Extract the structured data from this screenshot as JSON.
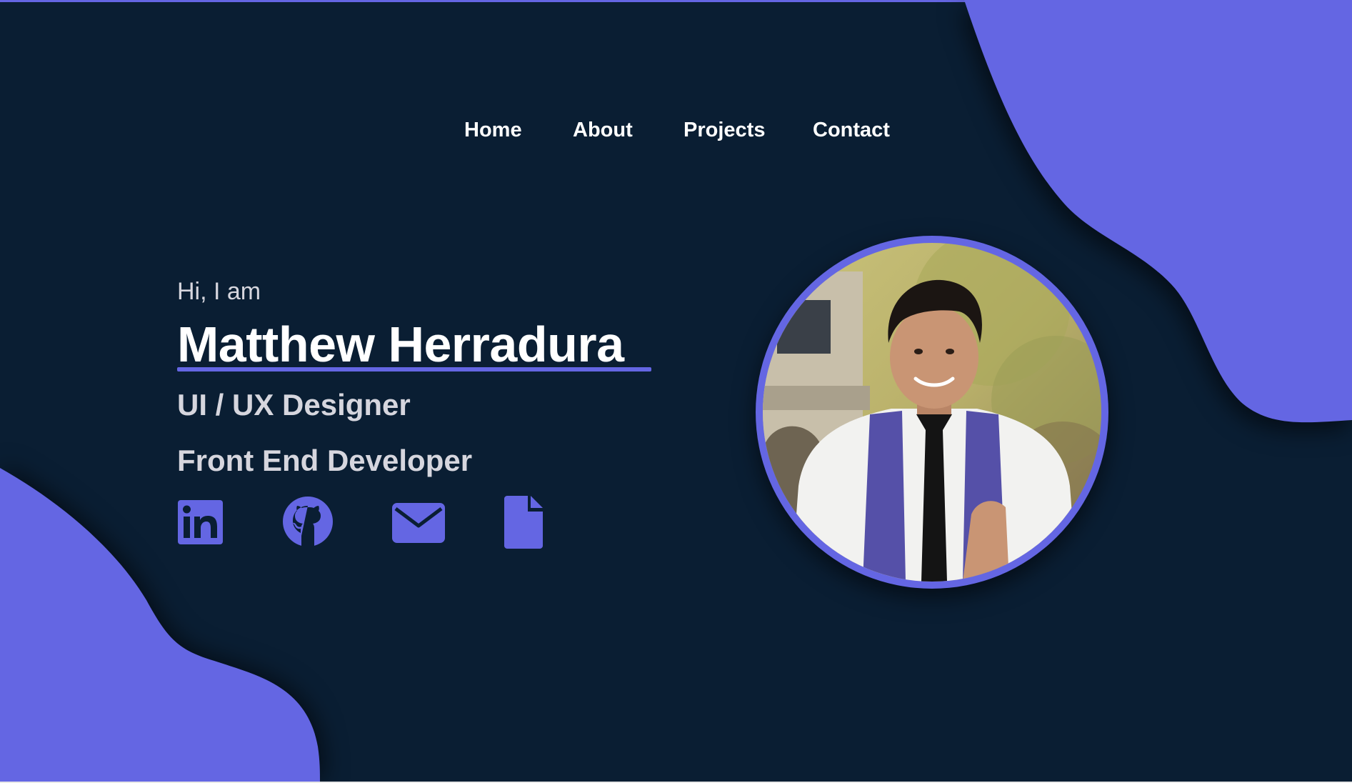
{
  "colors": {
    "background": "#0a1e33",
    "accent": "#6466e3",
    "text_primary": "#ffffff",
    "text_secondary": "#d6d6de"
  },
  "nav": {
    "items": [
      {
        "label": "Home"
      },
      {
        "label": "About"
      },
      {
        "label": "Projects"
      },
      {
        "label": "Contact"
      }
    ]
  },
  "hero": {
    "greeting": "Hi, I am",
    "name": "Matthew Herradura",
    "roles": [
      "UI / UX Designer",
      "Front End Developer"
    ]
  },
  "socials": [
    {
      "icon": "linkedin-icon"
    },
    {
      "icon": "github-icon"
    },
    {
      "icon": "mail-icon"
    },
    {
      "icon": "document-icon"
    }
  ],
  "avatar": {
    "icon": "profile-photo"
  }
}
